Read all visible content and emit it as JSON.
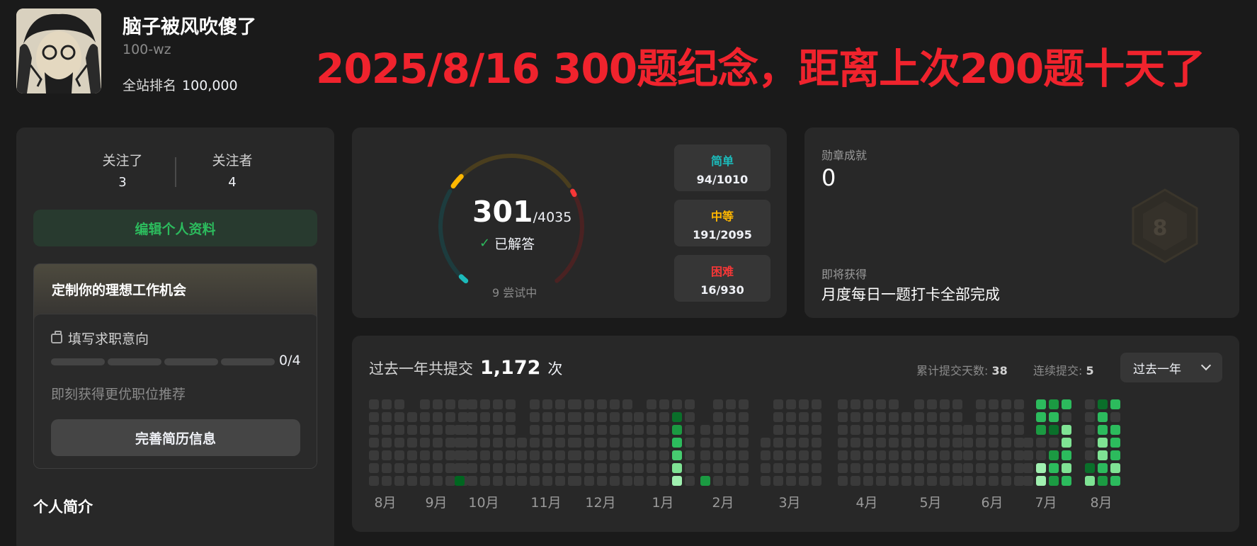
{
  "profile": {
    "username": "脑子被风吹傻了",
    "slug": "100-wz",
    "rank_label": "全站排名",
    "rank_value": "100,000"
  },
  "headline": "2025/8/16 300题纪念，距离上次200题十天了",
  "follow": {
    "following_label": "关注了",
    "following_count": "3",
    "followers_label": "关注者",
    "followers_count": "4"
  },
  "edit_profile_label": "编辑个人资料",
  "job": {
    "title": "定制你的理想工作机会",
    "intent_label": "填写求职意向",
    "progress_text": "0/4",
    "hint": "即刻获得更优职位推荐",
    "button_label": "完善简历信息"
  },
  "intro_title": "个人简介",
  "stats": {
    "solved": "301",
    "total": "/4035",
    "solved_label": "已解答",
    "attempting": "9 尝试中",
    "difficulties": [
      {
        "name": "简单",
        "value": "94/1010",
        "color": "#1cbaba"
      },
      {
        "name": "中等",
        "value": "191/2095",
        "color": "#ffb700"
      },
      {
        "name": "困难",
        "value": "16/930",
        "color": "#f63737"
      }
    ]
  },
  "badges": {
    "label": "勋章成就",
    "count": "0",
    "upcoming_label": "即将获得",
    "upcoming_name": "月度每日一题打卡全部完成"
  },
  "calendar": {
    "title_prefix": "过去一年共提交",
    "count": "1,172",
    "unit": "次",
    "total_days_label": "累计提交天数:",
    "total_days": "38",
    "streak_label": "连续提交:",
    "streak": "5",
    "range": "过去一年",
    "months": [
      "8月",
      "9月",
      "10月",
      "11月",
      "12月",
      "1月",
      "2月",
      "3月",
      "4月",
      "5月",
      "6月",
      "7月",
      "8月"
    ]
  },
  "colors": {
    "easy": "#1cbaba",
    "medium": "#ffb700",
    "hard": "#f63737",
    "accent_green": "#2cbb5d",
    "headline_red": "#f0232d"
  }
}
